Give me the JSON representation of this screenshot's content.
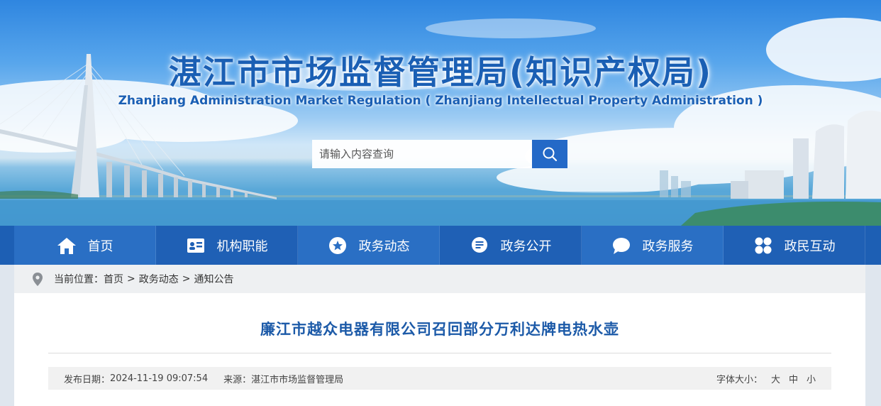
{
  "header": {
    "title": "湛江市市场监督管理局(知识产权局)",
    "subtitle": "Zhanjiang Administration Market Regulation ( Zhanjiang Intellectual Property Administration )"
  },
  "search": {
    "placeholder": "请输入内容查询",
    "icon": "search-icon"
  },
  "nav": {
    "items": [
      {
        "label": "首页",
        "icon": "home-icon"
      },
      {
        "label": "机构职能",
        "icon": "id-card-icon"
      },
      {
        "label": "政务动态",
        "icon": "star-icon"
      },
      {
        "label": "政务公开",
        "icon": "document-icon"
      },
      {
        "label": "政务服务",
        "icon": "chat-icon"
      },
      {
        "label": "政民互动",
        "icon": "grid-icon"
      }
    ]
  },
  "breadcrumb": {
    "prefix": "当前位置：",
    "items": [
      "首页",
      "政务动态",
      "通知公告"
    ],
    "separator": ">"
  },
  "article": {
    "title": "廉江市越众电器有限公司召回部分万利达牌电热水壶",
    "publish_label": "发布日期：",
    "publish_date": "2024-11-19 09:07:54",
    "source_label": "来源：",
    "source": "湛江市市场监督管理局",
    "font_size_label": "字体大小：",
    "font_sizes": [
      "大",
      "中",
      "小"
    ]
  },
  "colors": {
    "nav_bg": "#1d5fb4",
    "title_blue": "#1a5fb4",
    "article_title": "#1c5aa8",
    "search_button": "#2469c7"
  }
}
